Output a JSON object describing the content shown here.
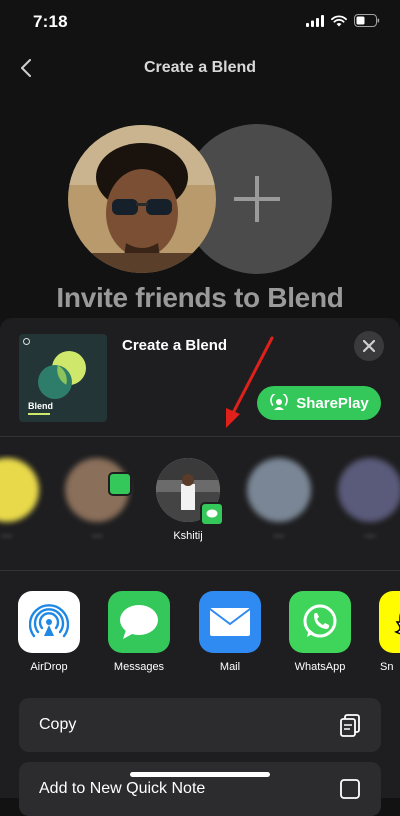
{
  "status_bar": {
    "time": "7:18"
  },
  "nav": {
    "title": "Create a Blend",
    "back_icon": "chevron-left-icon"
  },
  "hero": {
    "heading": "Invite friends to Blend",
    "plus_icon": "plus-icon"
  },
  "share_sheet": {
    "preview_label": "Blend",
    "title": "Create a Blend",
    "shareplay_label": "SharePlay",
    "people": [
      {
        "name": "",
        "blurred": true
      },
      {
        "name": "",
        "blurred": true
      },
      {
        "name": "Kshitij",
        "blurred": false
      },
      {
        "name": "",
        "blurred": true
      },
      {
        "name": "",
        "blurred": true
      }
    ],
    "apps": [
      {
        "label": "AirDrop",
        "icon": "airdrop-icon"
      },
      {
        "label": "Messages",
        "icon": "messages-icon"
      },
      {
        "label": "Mail",
        "icon": "mail-icon"
      },
      {
        "label": "WhatsApp",
        "icon": "whatsapp-icon"
      },
      {
        "label": "Sn",
        "icon": "snapchat-icon"
      }
    ],
    "actions": [
      {
        "label": "Copy",
        "icon": "copy-icon"
      },
      {
        "label": "Add to New Quick Note",
        "icon": "quick-note-icon"
      }
    ]
  },
  "colors": {
    "background": "#121212",
    "sheet": "#1e1e20",
    "shareplay_green": "#34c759",
    "annotation_red": "#e0201b"
  }
}
